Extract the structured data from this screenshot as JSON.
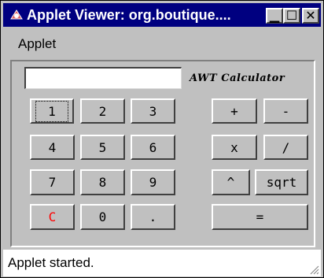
{
  "window": {
    "title": "Applet Viewer: org.boutique....",
    "minimize": "▁",
    "maximize": "☐",
    "close": "✕"
  },
  "menu": {
    "applet": "Applet"
  },
  "calculator": {
    "display_value": "",
    "label": "AWT Calculator",
    "keys": {
      "k1": "1",
      "k2": "2",
      "k3": "3",
      "plus": "+",
      "minus": "-",
      "k4": "4",
      "k5": "5",
      "k6": "6",
      "times": "x",
      "divide": "/",
      "k7": "7",
      "k8": "8",
      "k9": "9",
      "power": "^",
      "sqrt": "sqrt",
      "clear": "C",
      "k0": "0",
      "dot": ".",
      "equals": "="
    },
    "colors": {
      "clear_key": "#ff0000"
    }
  },
  "status": {
    "text": "Applet started."
  },
  "colors": {
    "title_bar": "#000080",
    "face": "#c0c0c0"
  }
}
